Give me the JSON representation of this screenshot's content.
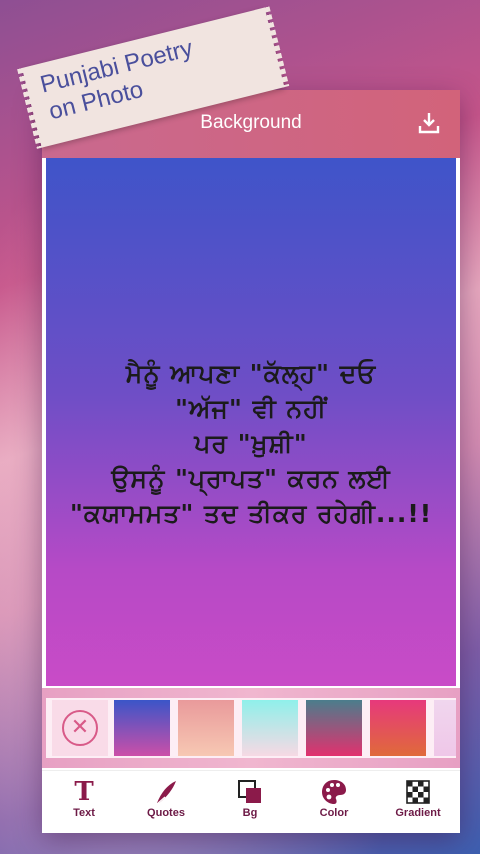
{
  "banner": {
    "line1": "Punjabi Poetry",
    "line2": "on Photo"
  },
  "appbar": {
    "title": "Background",
    "back_icon": "chevron-left-icon",
    "download_icon": "download-icon"
  },
  "poem": {
    "lines": [
      "ਮੈਨੂੰ ਆਪਣਾ \"ਕੱਲ੍ਹ\" ਦਓ",
      "\"ਅੱਜ\" ਵੀ ਨਹੀਂ",
      "ਪਰ \"ਖ਼ੁਸ਼ੀ\"",
      "ਉਸਨੂੰ \"ਪ੍ਰਾਪਤ\" ਕਰਨ ਲਈ",
      "\"ਕਯਾਮਮਤ\" ਤਦ ਤੀਕਰ ਰਹੇਗੀ...!!"
    ]
  },
  "swatches": [
    [
      "#3b55c8",
      "#cc4fa8"
    ],
    [
      "#e99a9b",
      "#f7c8b3"
    ],
    [
      "#8ff0ea",
      "#f7d9e4"
    ],
    [
      "#4b7d8c",
      "#e2316e"
    ],
    [
      "#e6397c",
      "#e06a3a"
    ],
    [
      "#f0d6ee",
      "#efc7e8"
    ]
  ],
  "nav": {
    "items": [
      {
        "label": "Text",
        "icon": "text-icon"
      },
      {
        "label": "Quotes",
        "icon": "quill-icon"
      },
      {
        "label": "Bg",
        "icon": "background-icon"
      },
      {
        "label": "Color",
        "icon": "palette-icon"
      },
      {
        "label": "Gradient",
        "icon": "gradient-icon"
      }
    ]
  },
  "colors": {
    "accent": "#d2637a",
    "nav_label": "#6d1a46"
  }
}
